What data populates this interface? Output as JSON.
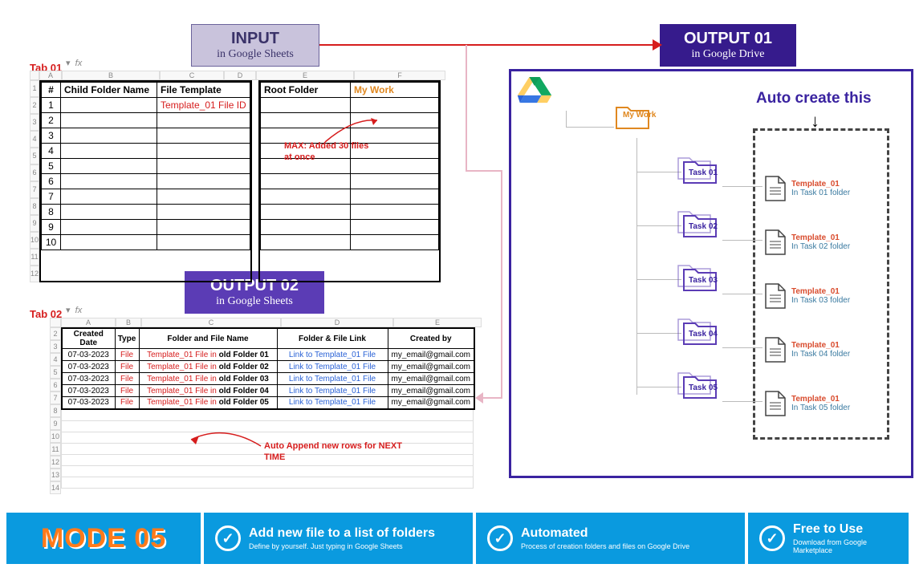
{
  "labels": {
    "input_big": "INPUT",
    "input_small": "in Google Sheets",
    "output1_big": "OUTPUT 01",
    "output1_small": "in Google Drive",
    "output2_big": "OUTPUT 02",
    "output2_small": "in Google Sheets",
    "tab1": "Tab 01",
    "tab2": "Tab 02",
    "fx": "fx",
    "dropdown_caret": "▾"
  },
  "table1": {
    "cols": [
      "A",
      "B",
      "C",
      "D",
      "E",
      "F"
    ],
    "headers": {
      "num": "#",
      "cfn": "Child Folder Name",
      "ft": "File Template",
      "rf": "Root Folder",
      "mw": "My Work"
    },
    "rows": [
      "1",
      "2",
      "3",
      "4",
      "5",
      "6",
      "7",
      "8",
      "9",
      "10"
    ],
    "template_cell": "Template_01 File ID",
    "row_nums_gutter": [
      "1",
      "2",
      "3",
      "4",
      "5",
      "6",
      "7",
      "8",
      "9",
      "10",
      "11",
      "12"
    ],
    "annotation": "MAX: Added 30 files at once"
  },
  "table2": {
    "cols": [
      "A",
      "B",
      "C",
      "D",
      "E"
    ],
    "row_nums": [
      "2",
      "3",
      "4",
      "5",
      "6",
      "7",
      "8",
      "9",
      "10",
      "11",
      "12",
      "13",
      "14"
    ],
    "headers": {
      "c1": "Created Date",
      "c2": "Type",
      "c3": "Folder and File Name",
      "c4": "Folder & File Link",
      "c5": "Created by"
    },
    "data": [
      {
        "d": "07-03-2023",
        "t": "File",
        "n_pre": "Template_01 File in ",
        "n_bold": "old Folder 01",
        "l": "Link to Template_01 File",
        "e": "my_email@gmail.com"
      },
      {
        "d": "07-03-2023",
        "t": "File",
        "n_pre": "Template_01 File in ",
        "n_bold": "old Folder 02",
        "l": "Link to Template_01 File",
        "e": "my_email@gmail.com"
      },
      {
        "d": "07-03-2023",
        "t": "File",
        "n_pre": "Template_01 File in ",
        "n_bold": "old Folder 03",
        "l": "Link to Template_01 File",
        "e": "my_email@gmail.com"
      },
      {
        "d": "07-03-2023",
        "t": "File",
        "n_pre": "Template_01 File in ",
        "n_bold": "old Folder 04",
        "l": "Link to Template_01 File",
        "e": "my_email@gmail.com"
      },
      {
        "d": "07-03-2023",
        "t": "File",
        "n_pre": "Template_01 File in ",
        "n_bold": "old Folder 05",
        "l": "Link to Template_01 File",
        "e": "my_email@gmail.com"
      }
    ],
    "annotation": "Auto Append new rows for NEXT TIME"
  },
  "drive": {
    "autocreate": "Auto create this",
    "root": "My Work",
    "tasks": [
      "Task 01",
      "Task 02",
      "Task 03",
      "Task 04",
      "Task 05"
    ],
    "files": [
      {
        "t": "Template_01",
        "s": "In Task 01 folder"
      },
      {
        "t": "Template_01",
        "s": "In Task 02 folder"
      },
      {
        "t": "Template_01",
        "s": "In Task 03 folder"
      },
      {
        "t": "Template_01",
        "s": "In Task 04 folder"
      },
      {
        "t": "Template_01",
        "s": "In Task 05 folder"
      }
    ]
  },
  "banner": {
    "mode": "MODE 05",
    "f1h": "Add new file to a list of folders",
    "f1s": "Define by yourself. Just typing in Google Sheets",
    "f2h": "Automated",
    "f2s": "Process of creation folders and files on Google Drive",
    "f3h": "Free to Use",
    "f3s": "Download from Google Marketplace"
  }
}
